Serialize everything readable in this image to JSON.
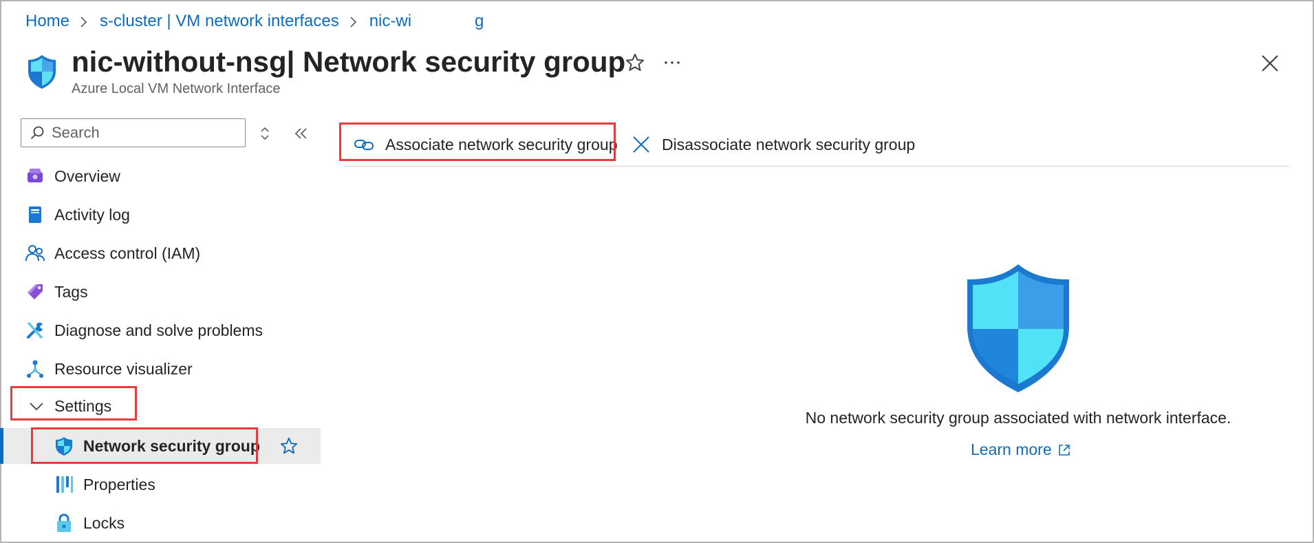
{
  "breadcrumb": {
    "home": "Home",
    "cluster": "s-cluster | VM network interfaces",
    "nic_part1": "nic-wi",
    "nic_part2": "g"
  },
  "header": {
    "title_bold": "nic-without-nsg",
    "title_rest": "| Network security group",
    "subtitle": "Azure Local VM Network Interface"
  },
  "search": {
    "placeholder": "Search"
  },
  "sidebar": {
    "items": [
      {
        "label": "Overview",
        "icon": "overview-icon"
      },
      {
        "label": "Activity log",
        "icon": "activity-log-icon"
      },
      {
        "label": "Access control (IAM)",
        "icon": "people-icon"
      },
      {
        "label": "Tags",
        "icon": "tag-icon"
      },
      {
        "label": "Diagnose and solve problems",
        "icon": "wrench-icon"
      },
      {
        "label": "Resource visualizer",
        "icon": "hierarchy-icon"
      },
      {
        "label": "Settings",
        "icon": "chevron-down-icon"
      },
      {
        "label": "Network security group",
        "icon": "shield-icon",
        "active": true
      },
      {
        "label": "Properties",
        "icon": "properties-icon"
      },
      {
        "label": "Locks",
        "icon": "lock-icon"
      }
    ]
  },
  "toolbar": {
    "associate": "Associate network security group",
    "disassociate": "Disassociate network security group"
  },
  "empty_state": {
    "message": "No network security group associated with network interface.",
    "learn_more": "Learn more"
  },
  "colors": {
    "accent": "#0f6cbd",
    "highlight": "#e23c3c",
    "active_bg": "#ebebeb"
  }
}
